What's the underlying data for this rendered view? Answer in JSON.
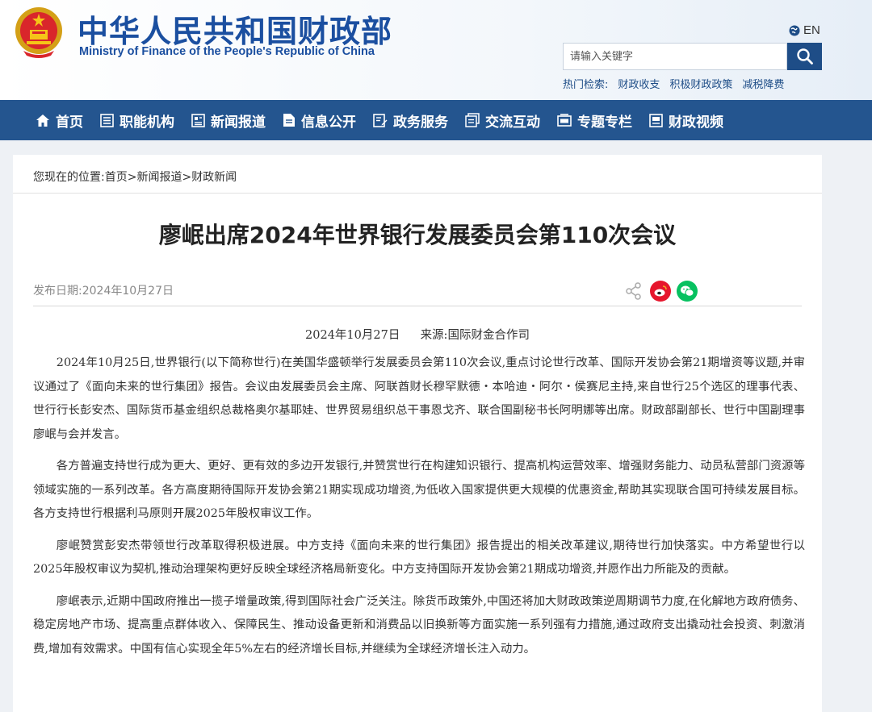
{
  "header": {
    "title_cn": "中华人民共和国财政部",
    "title_en": "Ministry of Finance of the People's Republic of China",
    "lang_label": "EN",
    "search": {
      "placeholder": "请输入关键字"
    },
    "hot_label": "热门检索:",
    "hot_links": [
      "财政收支",
      "积极财政政策",
      "减税降费"
    ]
  },
  "nav": {
    "items": [
      {
        "label": "首页",
        "icon": "home-icon"
      },
      {
        "label": "职能机构",
        "icon": "list-icon"
      },
      {
        "label": "新闻报道",
        "icon": "newspaper-icon"
      },
      {
        "label": "信息公开",
        "icon": "document-icon"
      },
      {
        "label": "政务服务",
        "icon": "edit-icon"
      },
      {
        "label": "交流互动",
        "icon": "chat-icon"
      },
      {
        "label": "专题专栏",
        "icon": "folder-icon"
      },
      {
        "label": "财政视频",
        "icon": "video-icon"
      }
    ]
  },
  "breadcrumb": {
    "prefix": "您现在的位置:",
    "items": [
      "首页",
      "新闻报道",
      "财政新闻"
    ],
    "separator": ">"
  },
  "article": {
    "title": "廖岷出席2024年世界银行发展委员会第110次会议",
    "publish_date": "发布日期:2024年10月27日",
    "meta_date": "2024年10月27日",
    "meta_source": "来源:国际财金合作司",
    "paragraphs": [
      "2024年10月25日,世界银行(以下简称世行)在美国华盛顿举行发展委员会第110次会议,重点讨论世行改革、国际开发协会第21期增资等议题,并审议通过了《面向未来的世行集团》报告。会议由发展委员会主席、阿联酋财长穆罕默德・本哈迪・阿尔・侯赛尼主持,来自世行25个选区的理事代表、世行行长彭安杰、国际货币基金组织总裁格奥尔基耶娃、世界贸易组织总干事恩戈齐、联合国副秘书长阿明娜等出席。财政部副部长、世行中国副理事廖岷与会并发言。",
      "各方普遍支持世行成为更大、更好、更有效的多边开发银行,并赞赏世行在构建知识银行、提高机构运营效率、增强财务能力、动员私营部门资源等领域实施的一系列改革。各方高度期待国际开发协会第21期实现成功增资,为低收入国家提供更大规模的优惠资金,帮助其实现联合国可持续发展目标。各方支持世行根据利马原则开展2025年股权审议工作。",
      "廖岷赞赏彭安杰带领世行改革取得积极进展。中方支持《面向未来的世行集团》报告提出的相关改革建议,期待世行加快落实。中方希望世行以2025年股权审议为契机,推动治理架构更好反映全球经济格局新变化。中方支持国际开发协会第21期成功增资,并愿作出力所能及的贡献。",
      "廖岷表示,近期中国政府推出一揽子增量政策,得到国际社会广泛关注。除货币政策外,中国还将加大财政政策逆周期调节力度,在化解地方政府债务、稳定房地产市场、提高重点群体收入、保障民生、推动设备更新和消费品以旧换新等方面实施一系列强有力措施,通过政府支出撬动社会投资、刺激消费,增加有效需求。中国有信心实现全年5%左右的经济增长目标,并继续为全球经济增长注入动力。"
    ]
  },
  "colors": {
    "brand_blue": "#1b4fa0",
    "nav_bg": "#24558f",
    "search_btn": "#1e4d87",
    "weibo_red": "#e6162d",
    "wechat_green": "#07c160"
  }
}
